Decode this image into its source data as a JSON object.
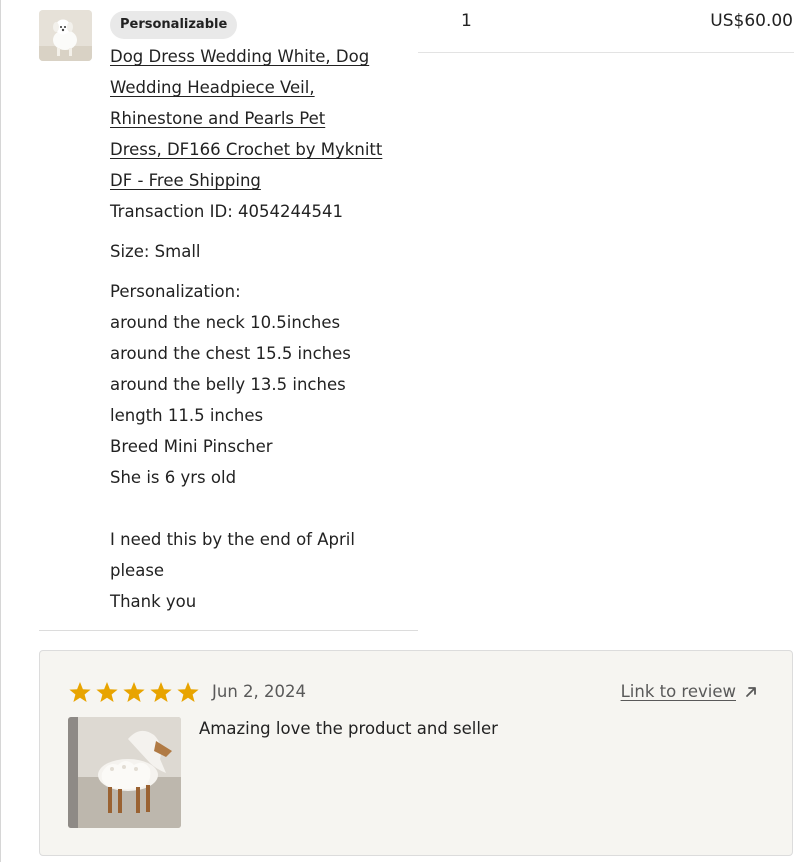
{
  "item": {
    "badge": "Personalizable",
    "quantity": "1",
    "price": "US$60.00",
    "title_lines": [
      "Dog Dress Wedding White, Dog",
      "Wedding Headpiece Veil,",
      "Rhinestone and Pearls Pet",
      "Dress, DF166 Crochet by Myknitt",
      "DF - Free Shipping"
    ],
    "transaction": "Transaction ID: 4054244541",
    "size": "Size: Small",
    "personalization_label": "Personalization:",
    "personalization_lines": [
      "around the neck 10.5inches",
      "around the chest 15.5 inches",
      "around the belly 13.5 inches",
      "length 11.5 inches",
      "Breed Mini Pinscher",
      "She is 6 yrs old",
      "",
      "I need this by the end of April",
      "please",
      "Thank you"
    ]
  },
  "review": {
    "rating": 5,
    "max_rating": 5,
    "star_color": "#e8a400",
    "date": "Jun 2, 2024",
    "link_label": "Link to review",
    "text": "Amazing love the product and seller"
  }
}
